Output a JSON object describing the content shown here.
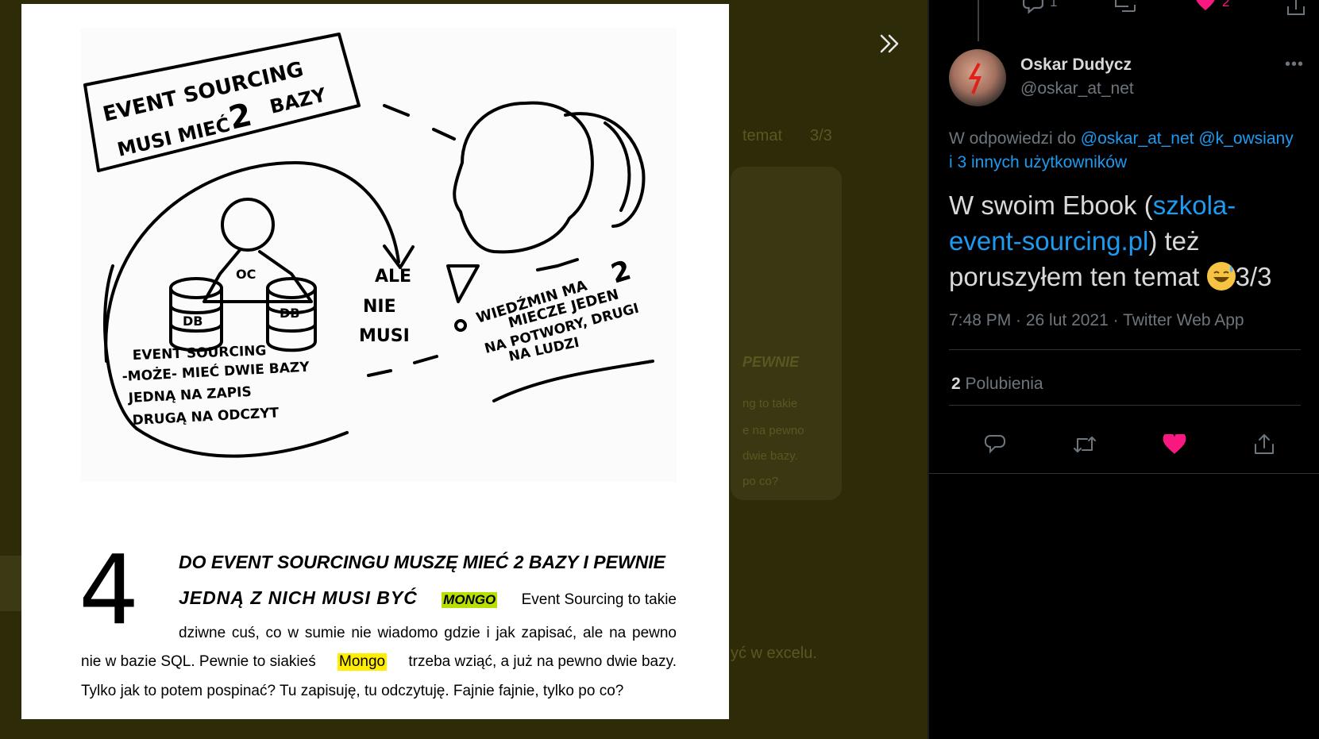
{
  "photo": {
    "drawing": {
      "banner_line1": "EVENT SOURCING",
      "banner_line2": "MUSI MIEĆ",
      "banner_big": "2",
      "banner_bazy": "BAZY",
      "db_left": "DB",
      "db_right": "DB",
      "oc": "OC",
      "ale": "ALE",
      "nie": "NIE",
      "musi": "MUSI",
      "caption_left_1": "EVENT SOURCING",
      "caption_left_2": "-MOŻE- MIEĆ DWIE BAZY",
      "caption_left_3": "JEDNĄ NA ZAPIS",
      "caption_left_4": "DRUGĄ NA ODCZYT",
      "caption_right_1": "WIEDŹMIN MA",
      "caption_right_big": "2",
      "caption_right_2": "MIECZE JEDEN",
      "caption_right_3": "NA POTWORY, DRUGI",
      "caption_right_4": "NA LUDZI"
    },
    "big_number": "4",
    "heading_line1": "DO EVENT SOURCINGU MUSZĘ MIEĆ 2 BAZY I PEWNIE",
    "heading_line2": "JEDNĄ Z NICH MUSI BYĆ",
    "mongo_badge": "MONGO",
    "line2_rest": "Event Sourcing to takie",
    "line3": "dziwne cuś, co w sumie nie wiadomo gdzie i jak zapisać, ale na pewno",
    "line4_start": "nie w bazie SQL. Pewnie to siakieś",
    "line4_mongo": "Mongo",
    "line4_end": "trzeba wziąć, a już na pewno dwie bazy.",
    "line5": "Tylko jak to potem pospinać? Tu zapisuję, tu odczytuję. Fajnie fajnie, tylko po co?"
  },
  "top_actions": {
    "reply_count": "1",
    "like_count": "2"
  },
  "tweet": {
    "author_name": "Oskar Dudycz",
    "author_handle": "@oskar_at_net",
    "reply_prefix": "W odpowiedzi do",
    "reply_user1": "@oskar_at_net",
    "reply_user2": "@k_owsiany",
    "reply_others": "i 3 innych użytkowników",
    "text_start": "W swoim Ebook (",
    "link": "szkola-event-sourcing.pl",
    "text_mid": ") też poruszyłem ten temat ",
    "text_end": "3/3",
    "meta": "7:48 PM · 26 lut 2021 · Twitter Web App",
    "likes_count": "2",
    "likes_label": "Polubienia"
  },
  "ghost_text": {
    "temat": "temat",
    "frac": "3/3",
    "pewnie": "PEWNIE",
    "g1": "ng to takie",
    "g2": "e na pewno",
    "g3": "dwie bazy.",
    "g4": "po co?",
    "excel": "yć w excelu."
  },
  "colors": {
    "backdrop": "#2e2c08",
    "link": "#1d9bf0",
    "like": "#f91880",
    "mongo_green": "#b7e000",
    "mongo_yellow": "#ffee00"
  },
  "icons": [
    "chevrons-right-icon",
    "reply-icon",
    "retweet-icon",
    "heart-icon",
    "share-icon",
    "more-icon",
    "sweat-smile-emoji"
  ]
}
